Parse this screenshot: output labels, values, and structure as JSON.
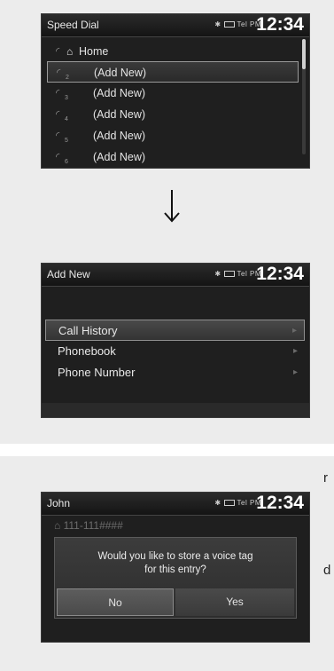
{
  "screen1": {
    "title": "Speed Dial",
    "clock": "12:34",
    "status_text": "Tel PM",
    "rows": [
      {
        "num": "",
        "label": "Home",
        "icon": "home-icon"
      },
      {
        "num": "2",
        "label": "(Add New)"
      },
      {
        "num": "3",
        "label": "(Add New)"
      },
      {
        "num": "4",
        "label": "(Add New)"
      },
      {
        "num": "5",
        "label": "(Add New)"
      },
      {
        "num": "6",
        "label": "(Add New)"
      }
    ]
  },
  "arrow": {
    "icon": "down-arrow-icon"
  },
  "screen2": {
    "title": "Add New",
    "clock": "12:34",
    "status_text": "Tel PM",
    "items": [
      {
        "label": "Call History"
      },
      {
        "label": "Phonebook"
      },
      {
        "label": "Phone Number"
      }
    ]
  },
  "side_letters": [
    "r",
    "d"
  ],
  "screen3": {
    "title": "John",
    "clock": "12:34",
    "status_text": "Tel PM",
    "entry": "111-111####",
    "dialog": {
      "line1": "Would you like to store a voice tag",
      "line2": "for this entry?",
      "no": "No",
      "yes": "Yes"
    }
  }
}
